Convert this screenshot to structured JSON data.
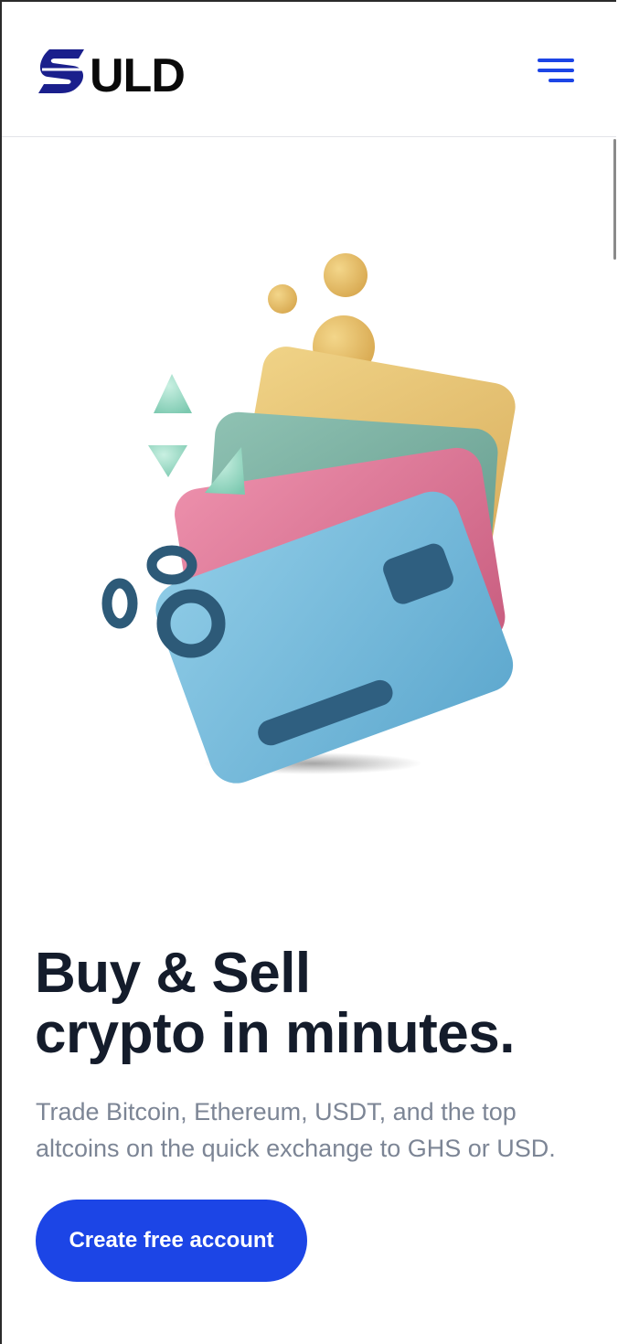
{
  "header": {
    "logo_text": "SULD",
    "menu_icon": "hamburger-menu-icon"
  },
  "hero": {
    "illustration_icon": "stacked-payment-cards-illustration",
    "headline_line1": "Buy & Sell",
    "headline_line2": "crypto in minutes.",
    "subtext": "Trade Bitcoin, Ethereum, USDT, and the top altcoins on the quick exchange to GHS or USD.",
    "cta_label": "Create free account"
  },
  "colors": {
    "brand_blue": "#1c45e6",
    "logo_navy": "#1a1f8c",
    "headline": "#141c2b",
    "subtext": "#7c8595"
  }
}
